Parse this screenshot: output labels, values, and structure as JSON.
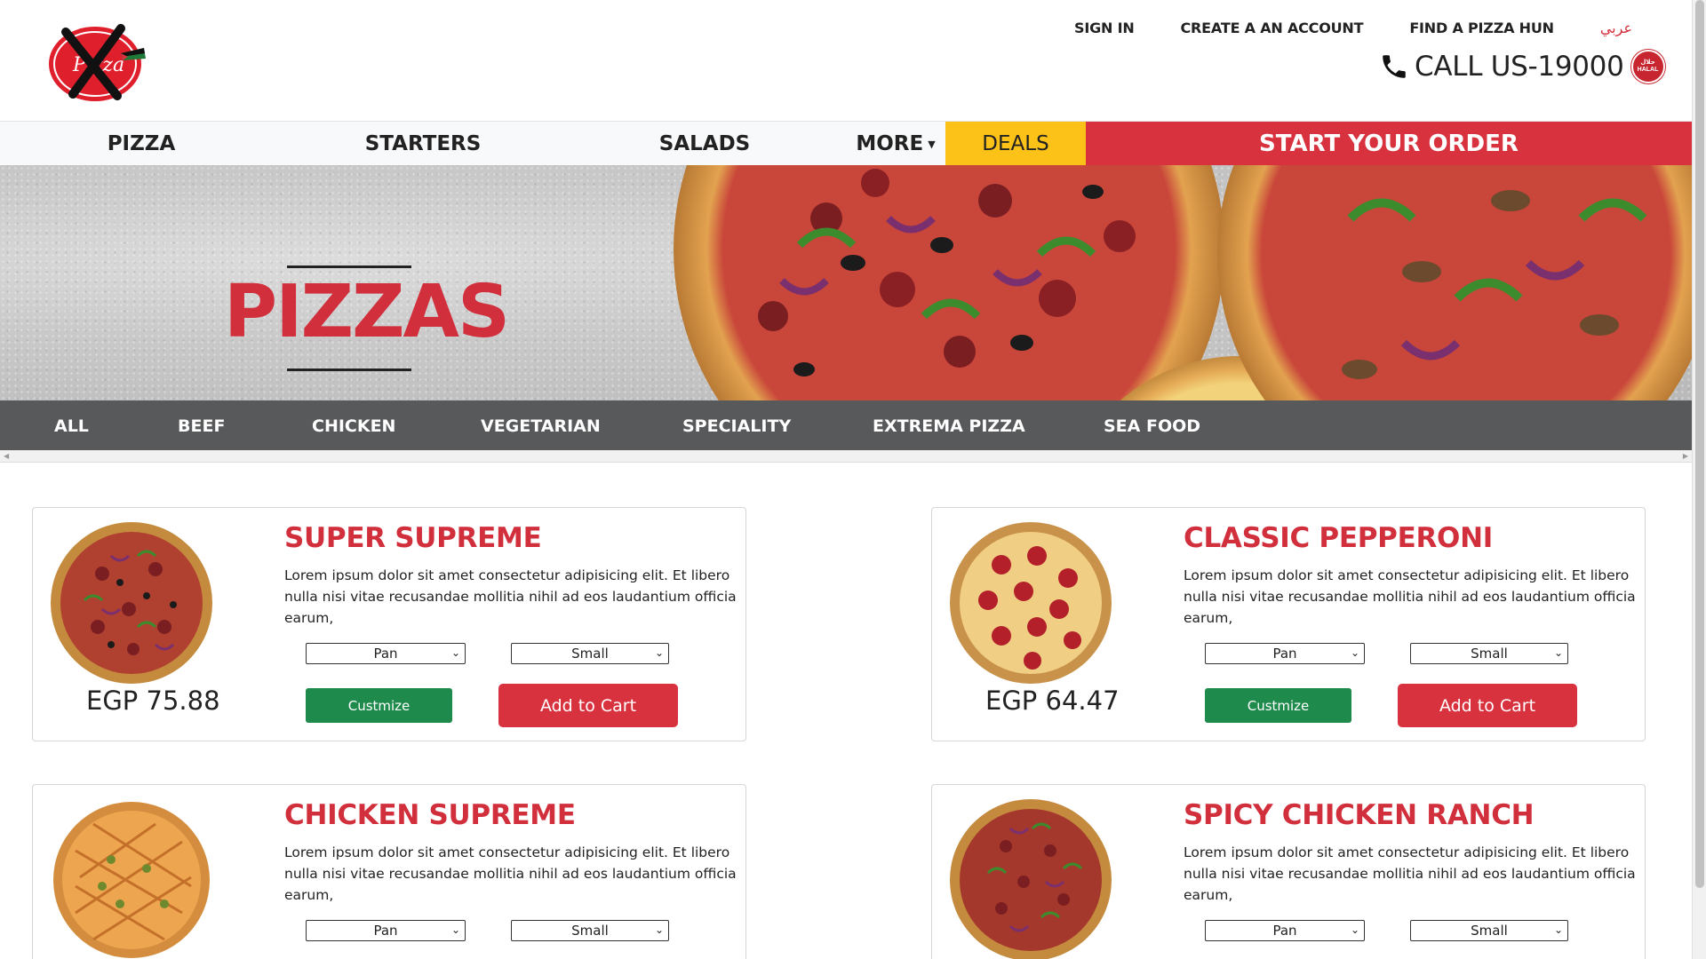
{
  "header": {
    "logo_icon": "crossed-out-pizza-logo-icon",
    "links": {
      "sign_in": "SIGN IN",
      "create_account": "CREATE A AN ACCOUNT",
      "find_store": "FIND A PIZZA HUN",
      "language": "عربي"
    },
    "call": {
      "phone_icon": "phone-icon",
      "text": "CALL US-19000",
      "halal_badge_icon": "halal-badge-icon"
    }
  },
  "main_nav": {
    "pizza": "PIZZA",
    "starters": "STARTERS",
    "salads": "SALADS",
    "more": "MORE",
    "deals": "DEALS",
    "start_order": "START YOUR ORDER"
  },
  "hero": {
    "title": "PIZZAS"
  },
  "filters": [
    "ALL",
    "BEEF",
    "CHICKEN",
    "VEGETARIAN",
    "SPECIALITY",
    "EXTREMA PIZZA",
    "SEA FOOD"
  ],
  "products": [
    {
      "name": "SUPER SUPREME",
      "description": "Lorem ipsum dolor sit amet consectetur adipisicing elit. Et libero nulla nisi vitae recusandae mollitia nihil ad eos laudantium officia earum,",
      "price": "EGP 75.88",
      "crust": "Pan",
      "size": "Small",
      "customize_label": "Custmize",
      "add_label": "Add to Cart"
    },
    {
      "name": "CLASSIC PEPPERONI",
      "description": "Lorem ipsum dolor sit amet consectetur adipisicing elit. Et libero nulla nisi vitae recusandae mollitia nihil ad eos laudantium officia earum,",
      "price": "EGP 64.47",
      "crust": "Pan",
      "size": "Small",
      "customize_label": "Custmize",
      "add_label": "Add to Cart"
    },
    {
      "name": "CHICKEN SUPREME",
      "description": "Lorem ipsum dolor sit amet consectetur adipisicing elit. Et libero nulla nisi vitae recusandae mollitia nihil ad eos laudantium officia earum,",
      "crust": "Pan",
      "size": "Small"
    },
    {
      "name": "SPICY CHICKEN RANCH",
      "description": "Lorem ipsum dolor sit amet consectetur adipisicing elit. Et libero nulla nisi vitae recusandae mollitia nihil ad eos laudantium officia earum,",
      "crust": "Pan",
      "size": "Small"
    }
  ],
  "colors": {
    "brand_red": "#d8323f",
    "deals_yellow": "#fdc218",
    "filter_bar_gray": "#58595b",
    "customize_green": "#1e8a4c"
  }
}
